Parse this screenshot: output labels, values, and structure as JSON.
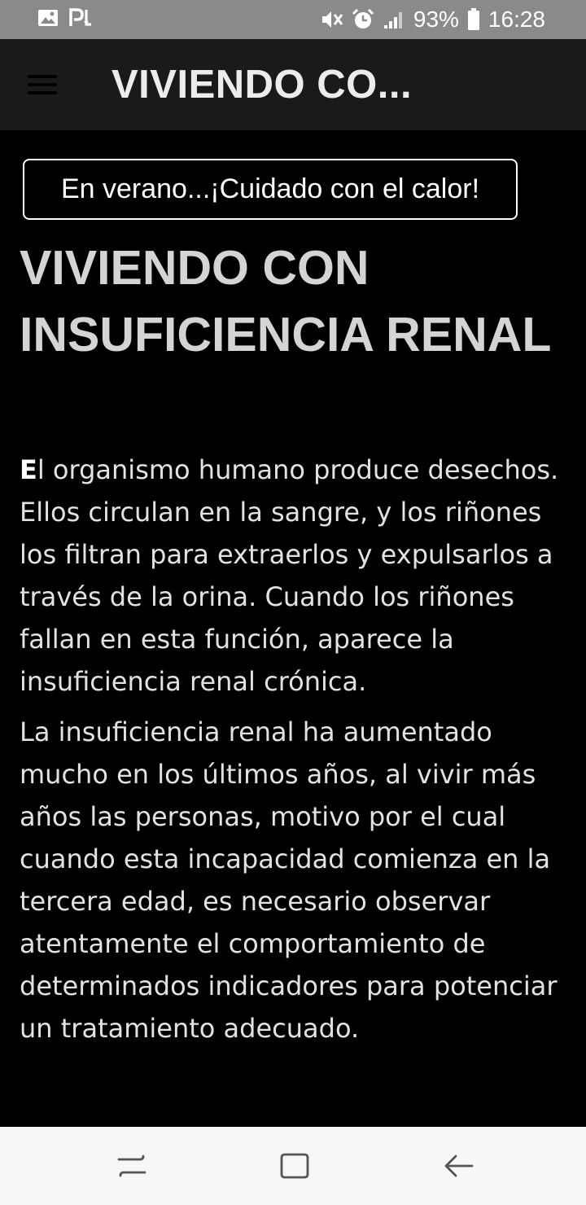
{
  "status_bar": {
    "battery_percent": "93%",
    "time": "16:28",
    "icons": [
      "gallery-icon",
      "pl-app-icon",
      "mute-icon",
      "alarm-icon",
      "signal-icon",
      "battery-icon"
    ]
  },
  "app_bar": {
    "title": "VIVIENDO CO..."
  },
  "content": {
    "banner_button": "En verano...¡Cuidado con el calor!",
    "page_title": "VIVIENDO CON INSUFICIENCIA RENAL",
    "paragraph1_dropcap": "E",
    "paragraph1_rest": "l organismo humano produce desechos. Ellos circulan en la sangre, y los riñones los filtran para extraerlos y expulsarlos a través de la orina. Cuando los riñones fallan en esta función, aparece la insuficiencia renal crónica.",
    "paragraph2": "La insuficiencia renal ha aumentado mucho en los últimos años, al vivir más años las personas, motivo por el cual cuando esta incapacidad comienza en la tercera edad, es necesario observar atentamente el comportamiento de determinados indicadores para potenciar un tratamiento adecuado."
  },
  "nav_bar": {
    "icons": [
      "recents-icon",
      "home-icon",
      "back-icon"
    ]
  },
  "colors": {
    "status_bar_bg": "#8a8a8a",
    "app_bar_bg": "#1a1a1a",
    "content_bg": "#000000",
    "title_text": "#d4d4d4",
    "body_text": "#e2e2e2",
    "nav_bar_bg": "#f7f7f7"
  }
}
